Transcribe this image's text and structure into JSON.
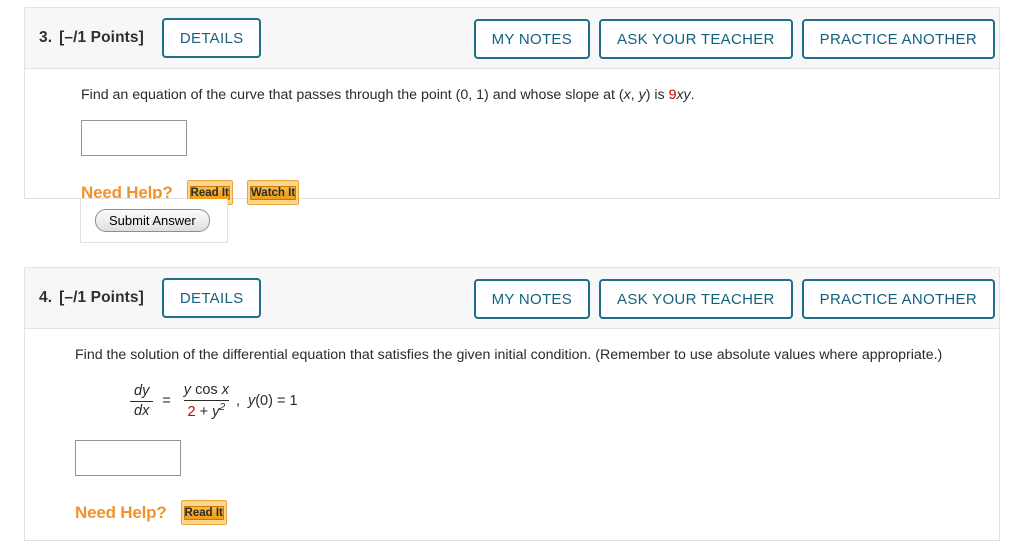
{
  "questions": [
    {
      "number": "3.",
      "points": "[–/1 Points]",
      "details_label": "DETAILS",
      "my_notes_label": "MY NOTES",
      "ask_teacher_label": "ASK YOUR TEACHER",
      "practice_another_label": "PRACTICE ANOTHER",
      "prompt": {
        "text_before": "Find an equation of the curve that passes through the point (0, 1) and whose slope at (",
        "var_x": "x",
        "comma": ", ",
        "var_y": "y",
        "text_mid": ") is ",
        "coef": "9",
        "expr_vars": "xy",
        "period": "."
      },
      "answer_value": "",
      "answer_placeholder": "",
      "need_help_label": "Need Help?",
      "help_buttons": [
        "Read It",
        "Watch It"
      ],
      "submit_label": "Submit Answer"
    },
    {
      "number": "4.",
      "points": "[–/1 Points]",
      "details_label": "DETAILS",
      "my_notes_label": "MY NOTES",
      "ask_teacher_label": "ASK YOUR TEACHER",
      "practice_another_label": "PRACTICE ANOTHER",
      "prompt": {
        "line1": "Find the solution of the differential equation that satisfies the given initial condition. (Remember to use absolute values where",
        "line2": "appropriate.)"
      },
      "equation": {
        "lhs_num": "dy",
        "lhs_den": "dx",
        "equals": "=",
        "rhs_num_y": "y",
        "rhs_num_cos": "cos",
        "rhs_num_x": "x",
        "rhs_den_coef": "2",
        "rhs_den_plus": "+",
        "rhs_den_y": "y",
        "rhs_den_exp": "2",
        "comma": ",",
        "initial_y": "y",
        "initial_arg": "(0)",
        "initial_equals": "=",
        "initial_value": "1"
      },
      "answer_value": "",
      "answer_placeholder": "",
      "need_help_label": "Need Help?",
      "help_buttons": [
        "Read It"
      ]
    }
  ],
  "colors": {
    "accent_blue": "#14617f",
    "highlight_red": "#cc0000",
    "help_orange": "#f0932b"
  }
}
